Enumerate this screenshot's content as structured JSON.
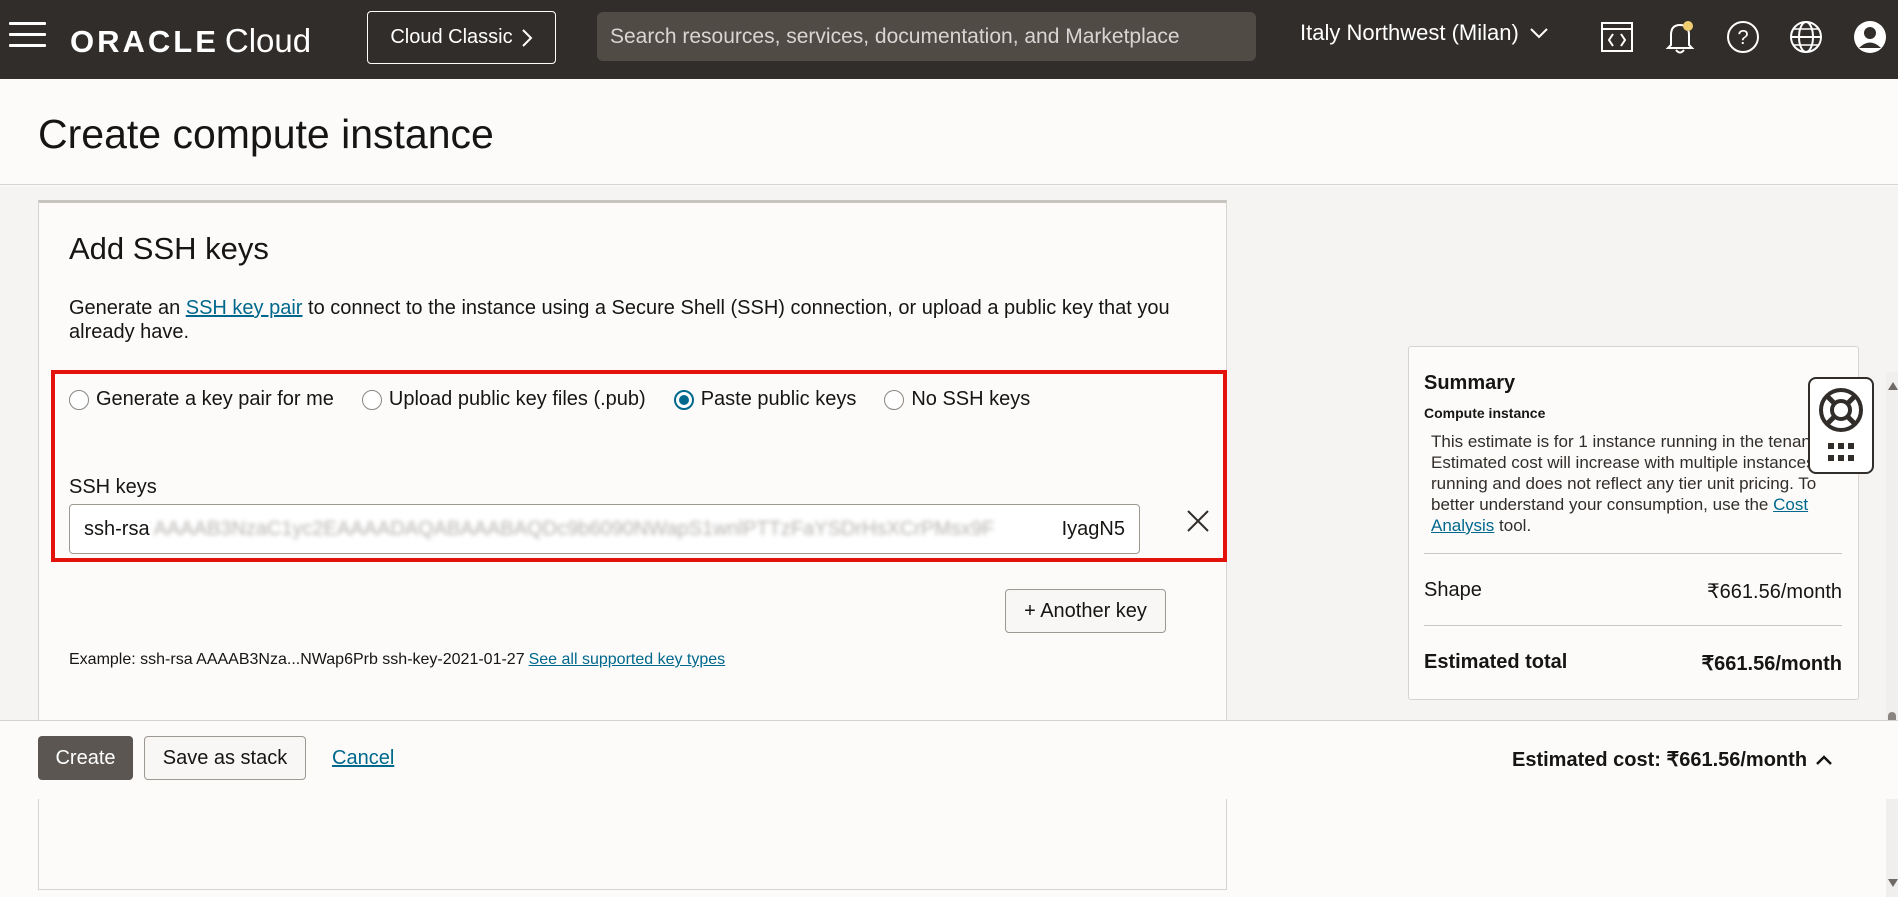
{
  "header": {
    "logo_oracle": "ORACLE",
    "logo_cloud": "Cloud",
    "classic_label": "Cloud Classic",
    "search_placeholder": "Search resources, services, documentation, and Marketplace",
    "region": "Italy Northwest (Milan)",
    "icons": [
      "hamburger-menu-icon",
      "code-editor-icon",
      "bell-icon",
      "help-icon",
      "globe-icon",
      "user-avatar-icon"
    ],
    "bg_color": "#312d2a"
  },
  "page": {
    "title": "Create compute instance"
  },
  "ssh": {
    "heading": "Add SSH keys",
    "desc_before": "Generate an ",
    "desc_link": "SSH key pair",
    "desc_after": " to connect to the instance using a Secure Shell (SSH) connection, or upload a public key that you already have.",
    "options": [
      {
        "label": "Generate a key pair for me",
        "selected": false
      },
      {
        "label": "Upload public key files (.pub)",
        "selected": false
      },
      {
        "label": "Paste public keys",
        "selected": true
      },
      {
        "label": "No SSH keys",
        "selected": false
      }
    ],
    "keys_label": "SSH keys",
    "key_prefix": "ssh-rsa",
    "key_blurred": "AAAAB3NzaC1yc2EAAAADAQABAAABAQDc9b6090NWapS1wnlPTTzFaYSDrHsXCrPMsx9F",
    "key_suffix": "IyagN5",
    "another_key": "+ Another key",
    "example": "Example: ssh-rsa AAAAB3Nza...NWap6Prb ssh-key-2021-01-27",
    "example_link": "See all supported key types",
    "highlight_color": "#e3120b"
  },
  "summary": {
    "title": "Summary",
    "subtitle": "Compute instance",
    "text_before": "This estimate is for 1 instance running in the tenancy. Estimated cost will increase with multiple instances running and does not reflect any tier unit pricing. To better understand your consumption, use the ",
    "text_link": "Cost Analysis",
    "text_after": " tool.",
    "shape_label": "Shape",
    "shape_value": "₹661.56/month",
    "total_label": "Estimated total",
    "total_value": "₹661.56/month"
  },
  "footer": {
    "create": "Create",
    "save_stack": "Save as stack",
    "cancel": "Cancel",
    "estimated_cost": "Estimated cost: ₹661.56/month"
  },
  "accent_color": "#00688c"
}
